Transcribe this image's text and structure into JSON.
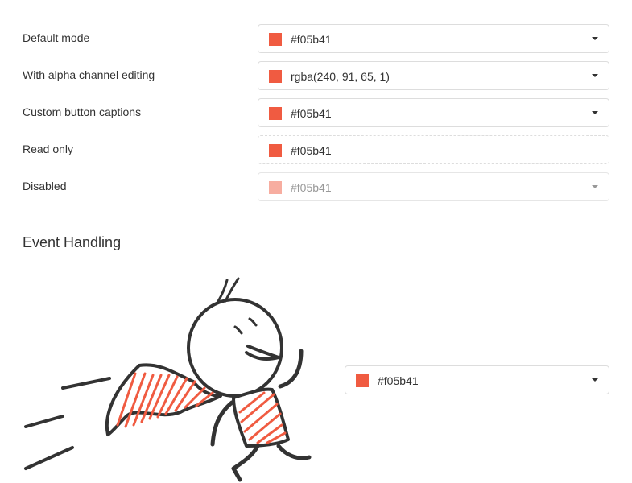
{
  "rows": [
    {
      "label": "Default mode",
      "value": "#f05b41",
      "swatch": "#f05b41"
    },
    {
      "label": "With alpha channel editing",
      "value": "rgba(240, 91, 65, 1)",
      "swatch": "#f05b41"
    },
    {
      "label": "Custom button captions",
      "value": "#f05b41",
      "swatch": "#f05b41"
    },
    {
      "label": "Read only",
      "value": "#f05b41",
      "swatch": "#f05b41"
    },
    {
      "label": "Disabled",
      "value": "#f05b41",
      "swatch": "#f7ada0"
    }
  ],
  "event_section": {
    "heading": "Event Handling",
    "value": "#f05b41",
    "swatch": "#f05b41",
    "illustration_icon": "running-superhero-illustration"
  },
  "colors": {
    "accent": "#f05b41",
    "border": "#dddddd",
    "text": "#333333"
  }
}
